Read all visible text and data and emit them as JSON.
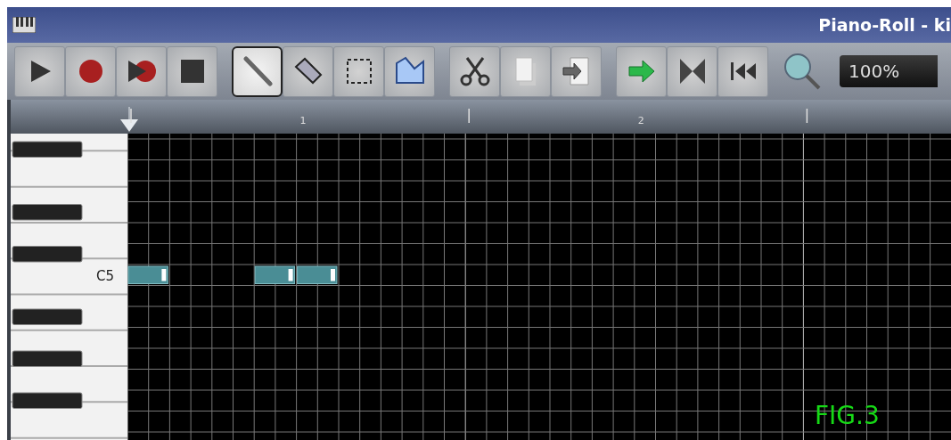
{
  "window": {
    "title": "Piano-Roll - ki"
  },
  "toolbar": {
    "groups": [
      [
        {
          "kind": "play",
          "selected": false
        },
        {
          "kind": "record",
          "selected": false
        },
        {
          "kind": "record-play",
          "selected": false
        },
        {
          "kind": "stop",
          "selected": false
        }
      ],
      [
        {
          "kind": "draw",
          "selected": true
        },
        {
          "kind": "erase",
          "selected": false
        },
        {
          "kind": "select",
          "selected": false
        },
        {
          "kind": "detune",
          "selected": false
        }
      ],
      [
        {
          "kind": "cut",
          "selected": false
        },
        {
          "kind": "copy",
          "selected": false
        },
        {
          "kind": "paste",
          "selected": false
        }
      ],
      [
        {
          "kind": "arrow",
          "selected": false
        },
        {
          "kind": "bowtie",
          "selected": false
        },
        {
          "kind": "skip-back",
          "selected": false
        }
      ]
    ],
    "zoom": "100%"
  },
  "timeline": {
    "markers": [
      "1",
      "2"
    ]
  },
  "keyboard": {
    "label": "C5"
  },
  "caption": "FIG.3"
}
